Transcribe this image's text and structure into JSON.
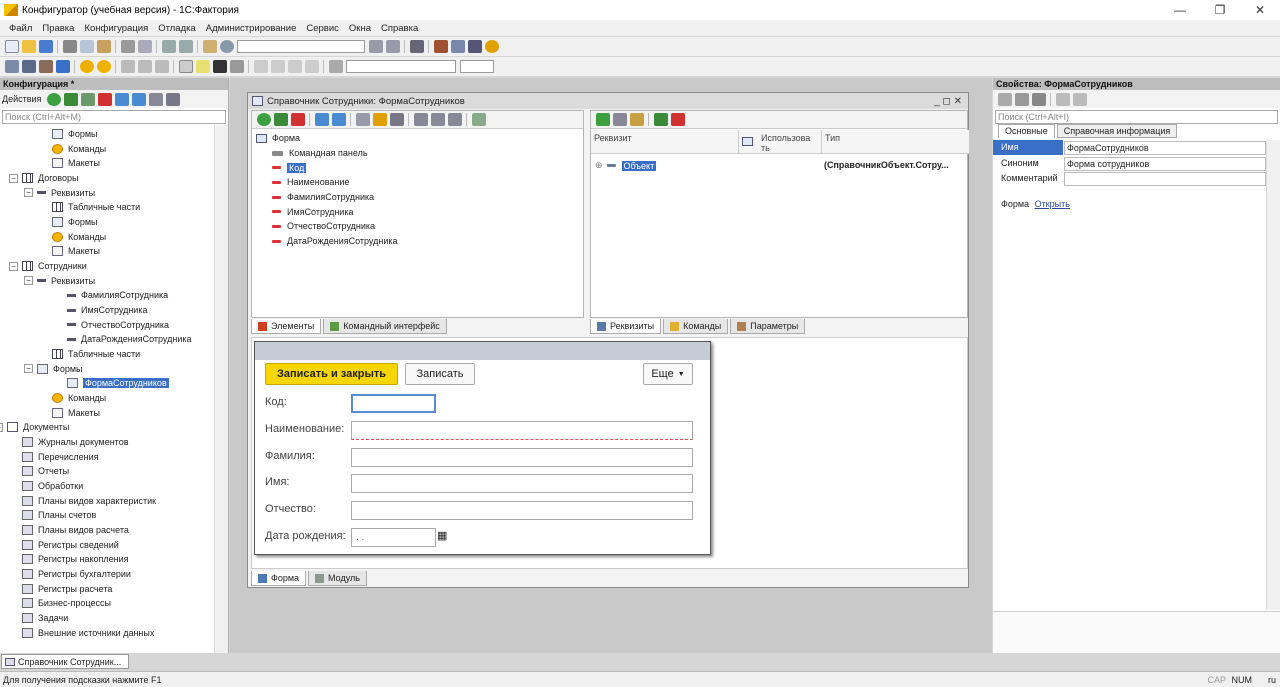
{
  "window": {
    "title": "Конфигуратор (учебная версия) - 1С:Фактория",
    "buttons": [
      "—",
      "❐",
      "✕"
    ]
  },
  "menu": [
    "Файл",
    "Правка",
    "Конфигурация",
    "Отладка",
    "Администрирование",
    "Сервис",
    "Окна",
    "Справка"
  ],
  "left_panel": {
    "title": "Конфигурация *",
    "actions_label": "Действия",
    "search_placeholder": "Поиск (Ctrl+Alt+M)",
    "tree": [
      {
        "label": "Формы",
        "icon": "form-icon"
      },
      {
        "label": "Команды",
        "icon": "command-icon"
      },
      {
        "label": "Макеты",
        "icon": "template-icon"
      },
      {
        "label": "Договоры",
        "icon": "catalog-icon",
        "expander": "⊖"
      },
      {
        "label": "Реквизиты",
        "icon": "attribute-icon",
        "expander": "⊖"
      },
      {
        "label": "Табличные части",
        "icon": "table-icon"
      },
      {
        "label": "Формы",
        "icon": "form-icon"
      },
      {
        "label": "Команды",
        "icon": "command-icon"
      },
      {
        "label": "Макеты",
        "icon": "template-icon"
      },
      {
        "label": "Сотрудники",
        "icon": "catalog-icon",
        "expander": "⊖"
      },
      {
        "label": "Реквизиты",
        "icon": "attribute-icon",
        "expander": "⊖"
      },
      {
        "label": "ФамилияСотрудника",
        "icon": "attribute-icon"
      },
      {
        "label": "ИмяСотрудника",
        "icon": "attribute-icon"
      },
      {
        "label": "ОтчествоСотрудника",
        "icon": "attribute-icon"
      },
      {
        "label": "ДатаРожденияСотрудника",
        "icon": "attribute-icon"
      },
      {
        "label": "Табличные части",
        "icon": "table-icon"
      },
      {
        "label": "Формы",
        "icon": "form-icon",
        "expander": "⊖"
      },
      {
        "label": "ФормаСотрудников",
        "icon": "form-icon",
        "selected": true
      },
      {
        "label": "Команды",
        "icon": "command-icon"
      },
      {
        "label": "Макеты",
        "icon": "template-icon"
      },
      {
        "label": "Документы",
        "icon": "document-icon",
        "expander": "⊕"
      },
      {
        "label": "Журналы документов",
        "icon": "journal-icon"
      },
      {
        "label": "Перечисления",
        "icon": "enum-icon"
      },
      {
        "label": "Отчеты",
        "icon": "report-icon"
      },
      {
        "label": "Обработки",
        "icon": "processing-icon"
      },
      {
        "label": "Планы видов характеристик",
        "icon": "chart-of-characteristics-icon"
      },
      {
        "label": "Планы счетов",
        "icon": "chart-of-accounts-icon"
      },
      {
        "label": "Планы видов расчета",
        "icon": "calculation-types-icon"
      },
      {
        "label": "Регистры сведений",
        "icon": "info-register-icon"
      },
      {
        "label": "Регистры накопления",
        "icon": "accumulation-register-icon"
      },
      {
        "label": "Регистры бухгалтерии",
        "icon": "accounting-register-icon"
      },
      {
        "label": "Регистры расчета",
        "icon": "calculation-register-icon"
      },
      {
        "label": "Бизнес-процессы",
        "icon": "business-process-icon"
      },
      {
        "label": "Задачи",
        "icon": "task-icon"
      },
      {
        "label": "Внешние источники данных",
        "icon": "external-source-icon"
      }
    ]
  },
  "editor": {
    "title": "Справочник Сотрудники: ФормаСотрудников",
    "elements": {
      "root": "Форма",
      "items": [
        "Командная панель",
        "Код",
        "Наименование",
        "ФамилияСотрудника",
        "ИмяСотрудника",
        "ОтчествоСотрудника",
        "ДатаРожденияСотрудника"
      ],
      "tabs": [
        "Элементы",
        "Командный интерфейс"
      ]
    },
    "attributes": {
      "columns": [
        "Реквизит",
        "Использова ть",
        "Тип"
      ],
      "row": {
        "name": "Объект",
        "type": "(СправочникОбъект.Сотру..."
      },
      "tabs": [
        "Реквизиты",
        "Команды",
        "Параметры"
      ]
    },
    "bottom_tabs": [
      "Форма",
      "Модуль"
    ]
  },
  "preview_form": {
    "save_close": "Записать и закрыть",
    "save": "Записать",
    "more": "Еще",
    "fields": [
      {
        "label": "Код:",
        "value": ""
      },
      {
        "label": "Наименование:",
        "value": ""
      },
      {
        "label": "Фамилия:",
        "value": ""
      },
      {
        "label": "Имя:",
        "value": ""
      },
      {
        "label": "Отчество:",
        "value": ""
      },
      {
        "label": "Дата рождения:",
        "value": " .  ."
      }
    ]
  },
  "properties": {
    "title": "Свойства: ФормаСотрудников",
    "search_placeholder": "Поиск (Ctrl+Alt+I)",
    "tabs": [
      "Основные",
      "Справочная информация"
    ],
    "rows": [
      {
        "name": "Имя",
        "value": "ФормаСотрудников"
      },
      {
        "name": "Синоним",
        "value": "Форма сотрудников"
      },
      {
        "name": "Комментарий",
        "value": ""
      }
    ],
    "form_label": "Форма",
    "open_link": "Открыть"
  },
  "taskbar": {
    "item": "Справочник Сотрудник..."
  },
  "statusbar": {
    "hint": "Для получения подсказки нажмите F1",
    "cap": "CAP",
    "num": "NUM",
    "lang": "ru"
  }
}
